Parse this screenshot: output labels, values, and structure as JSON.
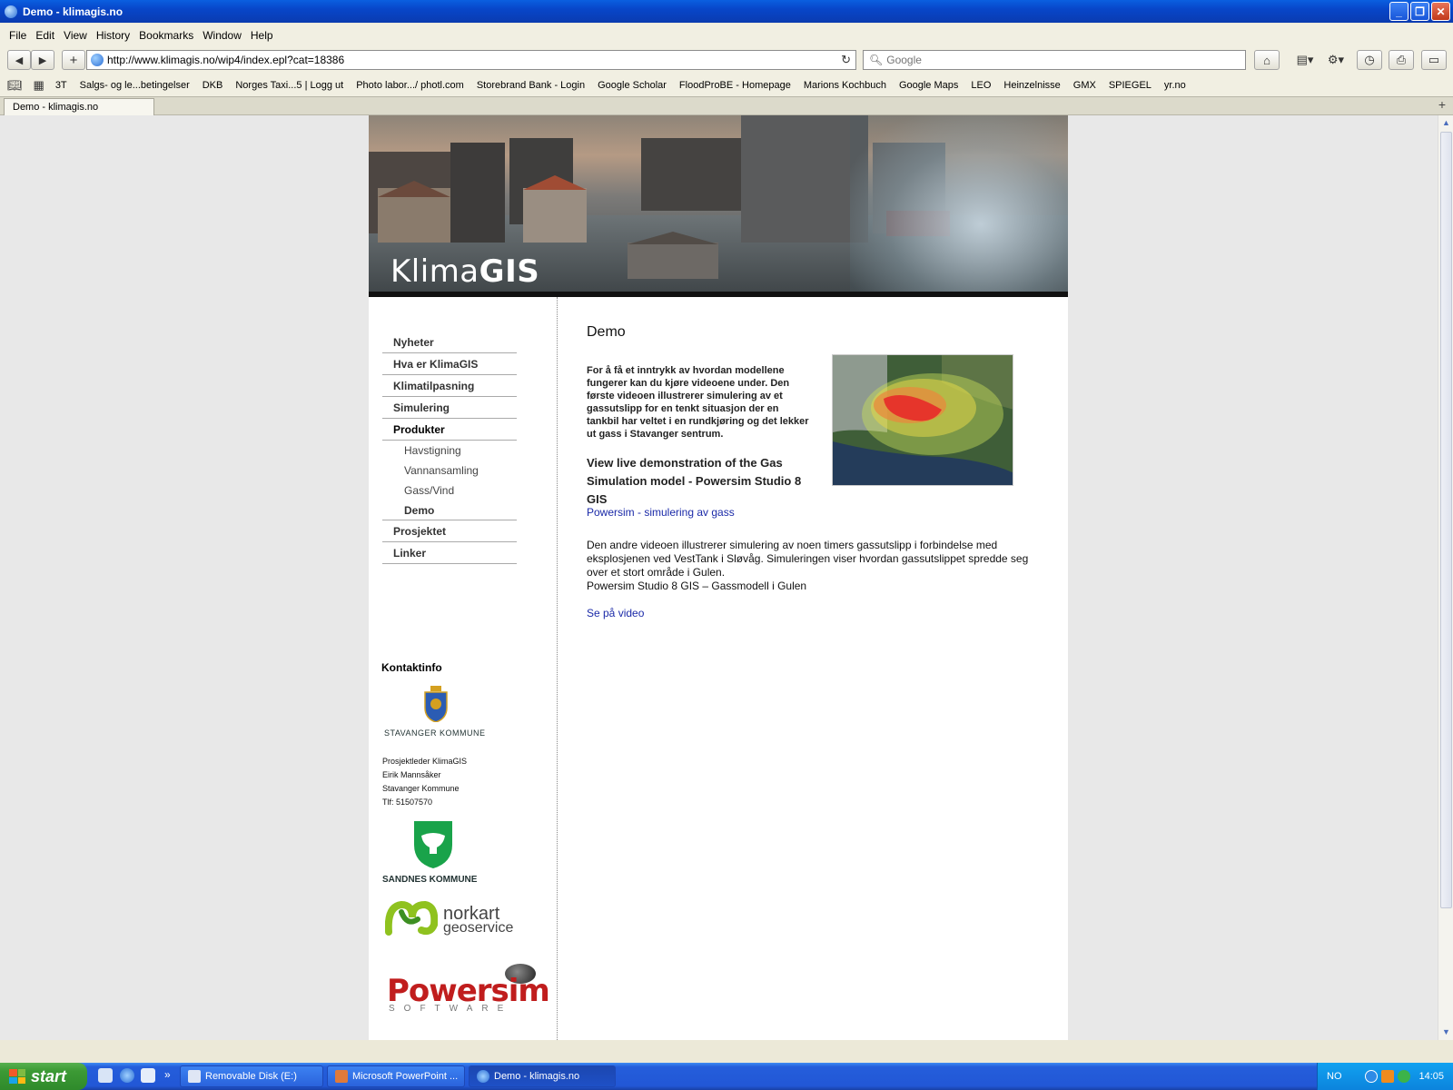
{
  "window": {
    "title": "Demo - klimagis.no"
  },
  "menu": [
    "File",
    "Edit",
    "View",
    "History",
    "Bookmarks",
    "Window",
    "Help"
  ],
  "toolbar": {
    "url": "http://www.klimagis.no/wip4/index.epl?cat=18386",
    "search_placeholder": "Google"
  },
  "bookmarks": [
    "3T",
    "Salgs- og le...betingelser",
    "DKB",
    "Norges Taxi...5 | Logg ut",
    "Photo labor.../ photl.com",
    "Storebrand Bank - Login",
    "Google Scholar",
    "FloodProBE - Homepage",
    "Marions Kochbuch",
    "Google Maps",
    "LEO",
    "Heinzelnisse",
    "GMX",
    "SPIEGEL",
    "yr.no"
  ],
  "tab": {
    "title": "Demo - klimagis.no"
  },
  "banner": {
    "logo_light": "Klima",
    "logo_bold": "GIS"
  },
  "sidebar": {
    "nav": [
      "Nyheter",
      "Hva er KlimaGIS",
      "Klimatilpasning",
      "Simulering",
      "Produkter"
    ],
    "sub": [
      "Havstigning",
      "Vannansamling",
      "Gass/Vind",
      "Demo"
    ],
    "nav_after": [
      "Prosjektet",
      "Linker"
    ],
    "contact_title": "Kontaktinfo",
    "stavanger_caption": "STAVANGER KOMMUNE",
    "contact_lines": [
      "Prosjektleder KlimaGIS",
      "Eirik Mannsåker",
      "Stavanger Kommune",
      "Tlf:  51507570"
    ],
    "sandnes_caption": "SANDNES KOMMUNE",
    "norkart_line1": "norkart",
    "norkart_line2": "geoservice",
    "powersim": "Powersim",
    "powersim_sub": "SOFTWARE"
  },
  "main": {
    "title": "Demo",
    "intro": "For å få et inntrykk av hvordan modellene fungerer kan du kjøre videoene under.  Den første videoen illustrerer simulering av et gassutslipp for en tenkt situasjon der en tankbil har veltet i en rundkjøring og det lekker ut gass i Stavanger sentrum.",
    "heading2": "View live demonstration of the Gas Simulation model - Powersim Studio 8 GIS",
    "link1": "Powersim - simulering av gass",
    "para": "Den andre videoen illustrerer simulering av noen timers gassutslipp i forbindelse med eksplosjenen ved VestTank i Sløvåg. Simuleringen viser hvordan gassutslippet spredde seg over et stort område i Gulen.",
    "para2": "Powersim Studio 8 GIS – Gassmodell i Gulen",
    "link2": "Se på video"
  },
  "taskbar": {
    "start": "start",
    "tasks": [
      "Removable Disk (E:)",
      "Microsoft PowerPoint ...",
      "Demo - klimagis.no"
    ],
    "lang": "NO",
    "clock": "14:05"
  }
}
